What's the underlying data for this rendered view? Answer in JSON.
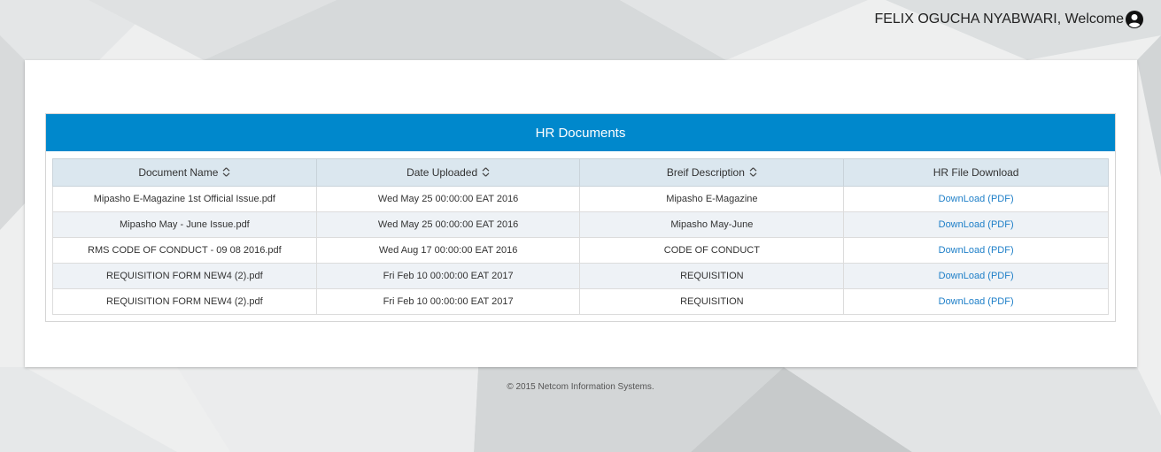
{
  "header": {
    "user_name": "FELIX OGUCHA NYABWARI, Welcome",
    "user_icon": "user-circle-icon"
  },
  "panel": {
    "title": "HR Documents",
    "accent_color": "#0088cc"
  },
  "table": {
    "columns": [
      {
        "label": "Document Name",
        "sortable": true
      },
      {
        "label": "Date Uploaded",
        "sortable": true
      },
      {
        "label": "Breif Description",
        "sortable": true
      },
      {
        "label": "HR File Download",
        "sortable": false
      }
    ],
    "rows": [
      {
        "name": "Mipasho E-Magazine 1st Official Issue.pdf",
        "date": "Wed May 25 00:00:00 EAT 2016",
        "description": "Mipasho E-Magazine",
        "download": "DownLoad (PDF)"
      },
      {
        "name": "Mipasho May - June Issue.pdf",
        "date": "Wed May 25 00:00:00 EAT 2016",
        "description": "Mipasho May-June",
        "download": "DownLoad (PDF)"
      },
      {
        "name": "RMS CODE OF CONDUCT - 09 08 2016.pdf",
        "date": "Wed Aug 17 00:00:00 EAT 2016",
        "description": "CODE OF CONDUCT",
        "download": "DownLoad (PDF)"
      },
      {
        "name": "REQUISITION FORM NEW4 (2).pdf",
        "date": "Fri Feb 10 00:00:00 EAT 2017",
        "description": "REQUISITION",
        "download": "DownLoad (PDF)"
      },
      {
        "name": "REQUISITION FORM NEW4 (2).pdf",
        "date": "Fri Feb 10 00:00:00 EAT 2017",
        "description": "REQUISITION",
        "download": "DownLoad (PDF)"
      }
    ]
  },
  "footer": {
    "copyright": "© 2015 Netcom Information Systems."
  }
}
